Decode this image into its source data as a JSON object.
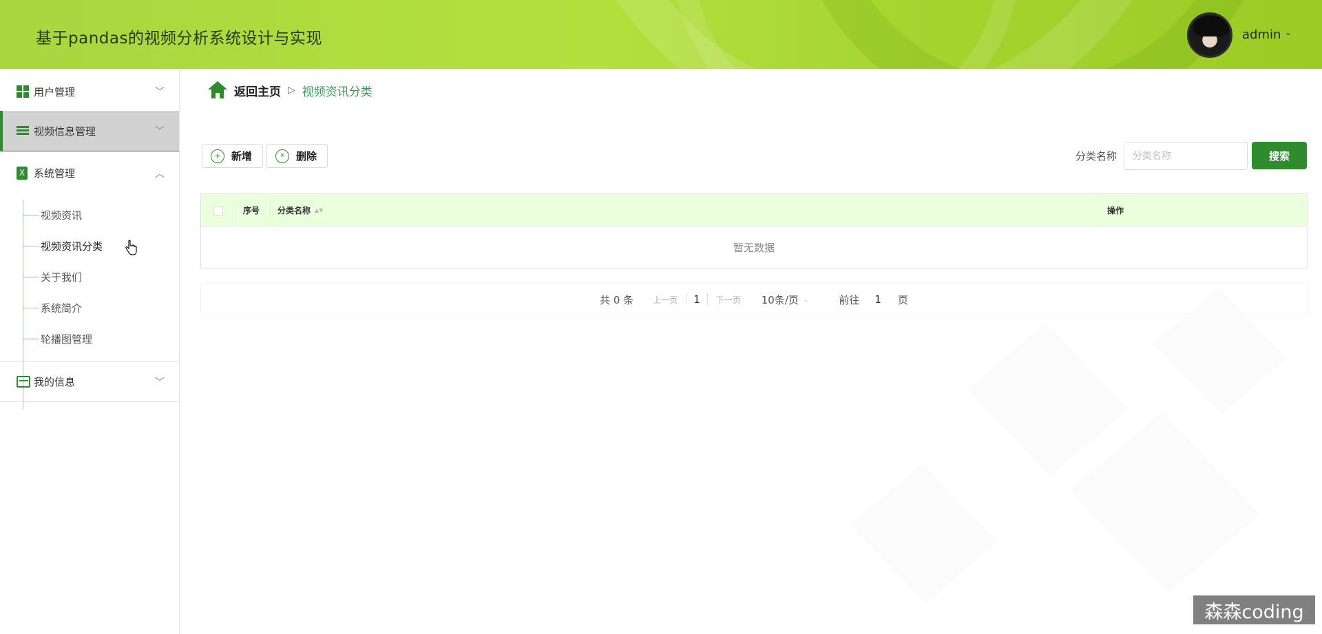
{
  "header": {
    "app_title": "基于pandas的视频分析系统设计与实现",
    "username": "admin",
    "caret": "⌄"
  },
  "sidebar": {
    "items": [
      {
        "label": "用户管理",
        "icon": "grid-icon",
        "expanded": false,
        "arrow": "﹀"
      },
      {
        "label": "视频信息管理",
        "icon": "list-icon",
        "expanded": false,
        "active": true,
        "arrow": "﹀"
      },
      {
        "label": "系统管理",
        "icon": "clipboard-icon",
        "expanded": true,
        "arrow": "︿"
      },
      {
        "label": "我的信息",
        "icon": "card-icon",
        "expanded": false,
        "arrow": "﹀"
      }
    ],
    "system_sub_items": [
      {
        "label": "视频资讯"
      },
      {
        "label": "视频资讯分类",
        "active": true
      },
      {
        "label": "关于我们"
      },
      {
        "label": "系统简介"
      },
      {
        "label": "轮播图管理"
      }
    ],
    "clip_glyph": "X"
  },
  "breadcrumb": {
    "home": "返回主页",
    "separator": "▷",
    "current": "视频资讯分类"
  },
  "toolbar": {
    "add_label": "新增",
    "add_glyph": "+",
    "delete_label": "删除",
    "delete_glyph": "×"
  },
  "search": {
    "label": "分类名称",
    "placeholder": "分类名称",
    "value": "",
    "button": "搜索"
  },
  "table": {
    "columns": [
      "序号",
      "分类名称",
      "操作"
    ],
    "sort_glyph": "▲▼",
    "empty_text": "暂无数据",
    "rows": []
  },
  "pagination": {
    "total": "共 0 条",
    "prev": "上一页",
    "page": "1",
    "next": "下一页",
    "page_size": "10条/页",
    "size_caret": "⌄",
    "goto_label": "前往",
    "goto_value": "1",
    "goto_unit": "页"
  },
  "watermark": "森森coding",
  "colors": {
    "accent": "#2e8b2e",
    "header_bg": "#b4e03e",
    "table_header_bg": "#eaffdc",
    "active_menu_bg": "#d2d2d2"
  }
}
